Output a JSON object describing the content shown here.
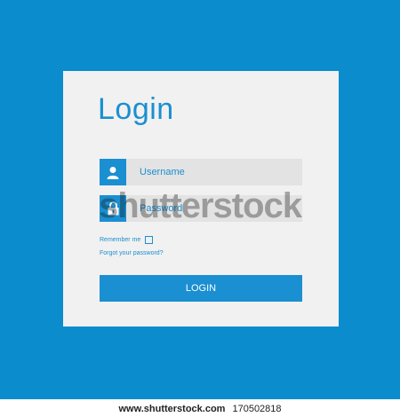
{
  "login": {
    "title": "Login",
    "username_placeholder": "Username",
    "password_placeholder": "Password",
    "remember_label": "Remember me",
    "forgot_label": "Forgot your password?",
    "button_label": "LOGIN",
    "icons": {
      "username": "user-icon",
      "password": "lock-icon"
    }
  },
  "colors": {
    "background": "#0a8ccd",
    "card": "#f1f1f1",
    "accent": "#1a8fd1",
    "field": "#e3e3e3"
  },
  "watermark": {
    "text": "shutterstock"
  },
  "footer": {
    "site": "www.shutterstock.com",
    "id": "170502818"
  }
}
